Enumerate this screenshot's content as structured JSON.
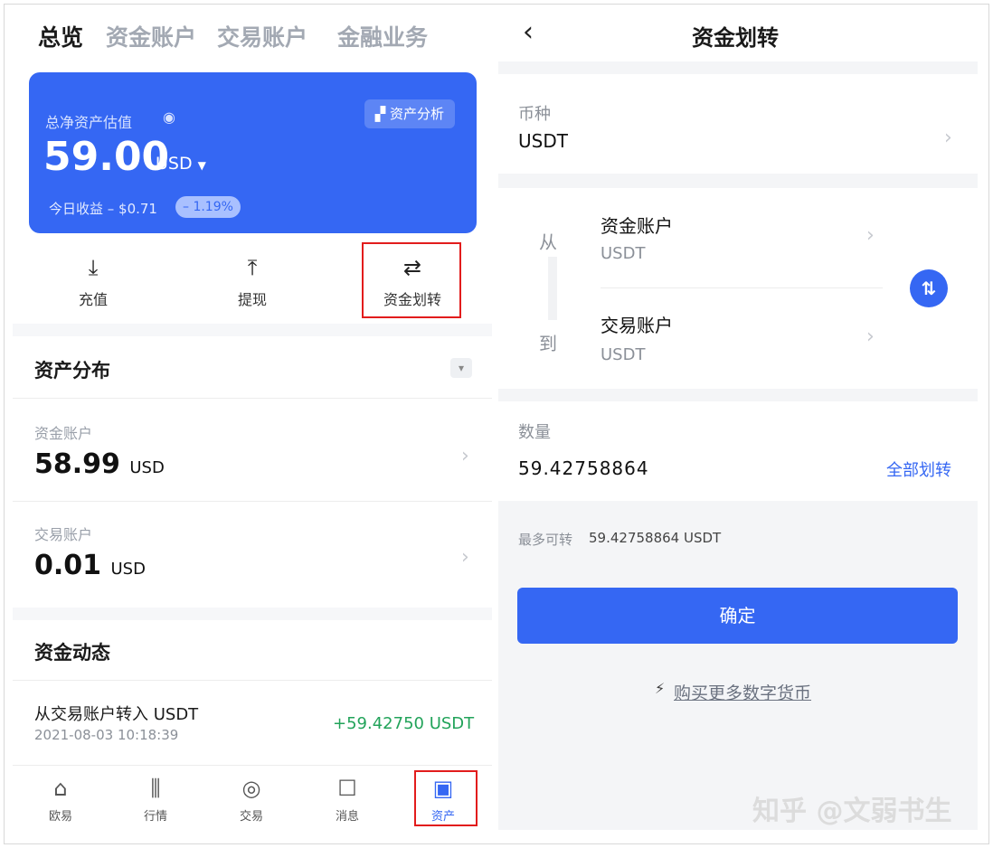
{
  "left": {
    "tabs": [
      "总览",
      "资金账户",
      "交易账户",
      "金融业务"
    ],
    "card": {
      "label": "总净资产估值",
      "analysis_btn": "资产分析",
      "amount": "59.00",
      "currency": "USD",
      "pnl_label": "今日收益 – $0.71",
      "pnl_pct": "– 1.19%"
    },
    "actions": [
      {
        "label": "充值",
        "icon": "download-icon"
      },
      {
        "label": "提现",
        "icon": "upload-icon"
      },
      {
        "label": "资金划转",
        "icon": "transfer-icon"
      }
    ],
    "distribution": {
      "title": "资产分布",
      "items": [
        {
          "label": "资金账户",
          "value": "58.99",
          "unit": "USD"
        },
        {
          "label": "交易账户",
          "value": "0.01",
          "unit": "USD"
        }
      ]
    },
    "activity": {
      "title": "资金动态",
      "item": {
        "title": "从交易账户转入 USDT",
        "time": "2021-08-03 10:18:39",
        "amount": "+59.42750 USDT"
      }
    },
    "nav": [
      {
        "label": "欧易",
        "icon": "home-icon"
      },
      {
        "label": "行情",
        "icon": "chart-icon"
      },
      {
        "label": "交易",
        "icon": "trade-icon"
      },
      {
        "label": "消息",
        "icon": "message-icon"
      },
      {
        "label": "资产",
        "icon": "wallet-icon"
      }
    ]
  },
  "right": {
    "title": "资金划转",
    "currency_label": "币种",
    "currency_value": "USDT",
    "from_label": "从",
    "to_label": "到",
    "from_account": "资金账户",
    "from_currency": "USDT",
    "to_account": "交易账户",
    "to_currency": "USDT",
    "amount_label": "数量",
    "amount_value": "59.42758864",
    "all_button": "全部划转",
    "max_label": "最多可转",
    "max_value": "59.42758864 USDT",
    "confirm": "确定",
    "buy_link": "购买更多数字货币"
  },
  "watermark": "知乎 @文弱书生",
  "colors": {
    "brand": "#3567f3",
    "highlight": "#e21c1c",
    "positive": "#22a35a"
  }
}
